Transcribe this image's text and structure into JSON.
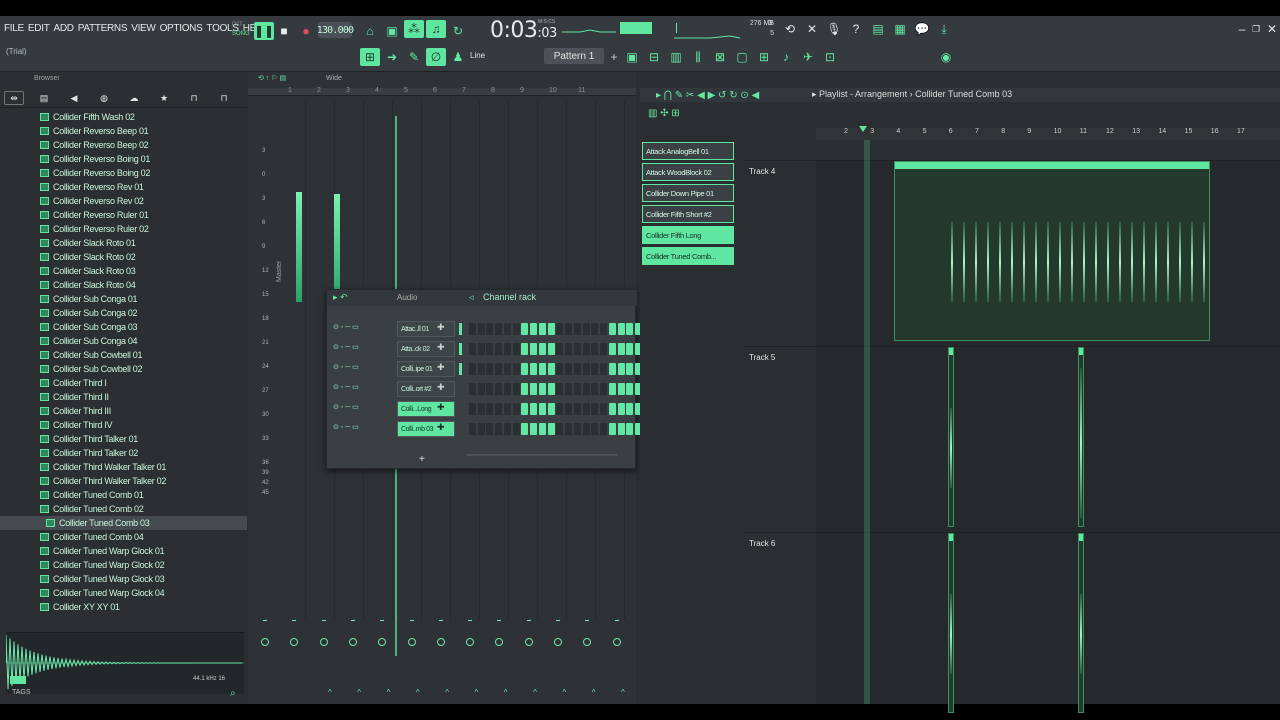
{
  "menu": [
    "FILE",
    "EDIT",
    "ADD",
    "PATTERNS",
    "VIEW",
    "OPTIONS",
    "TOOLS",
    "HELP"
  ],
  "trial_label": "(Trial)",
  "transport": {
    "pat_label": "PAT",
    "song_label": "SONG",
    "tempo": "130.000",
    "time_main": "0:03",
    "time_sub": ":03",
    "time_caption": "M:S:CS",
    "cpu_top": "3",
    "mem": "276 MB",
    "voices": "5"
  },
  "toolbar": {
    "snap_label": "Line",
    "pattern_label": "Pattern 1"
  },
  "browser": {
    "header": "Browser",
    "items": [
      "Collider Fifth Wash 02",
      "Collider Reverso Beep 01",
      "Collider Reverso Beep 02",
      "Collider Reverso Boing 01",
      "Collider Reverso Boing 02",
      "Collider Reverso Rev 01",
      "Collider Reverso Rev 02",
      "Collider Reverso Ruler 01",
      "Collider Reverso Ruler 02",
      "Collider Slack Roto 01",
      "Collider Slack Roto 02",
      "Collider Slack Roto 03",
      "Collider Slack Roto 04",
      "Collider Sub Conga 01",
      "Collider Sub Conga 02",
      "Collider Sub Conga 03",
      "Collider Sub Conga 04",
      "Collider Sub Cowbell 01",
      "Collider Sub Cowbell 02",
      "Collider Third I",
      "Collider Third II",
      "Collider Third III",
      "Collider Third IV",
      "Collider Third Talker 01",
      "Collider Third Talker 02",
      "Collider Third Walker Talker 01",
      "Collider Third Walker Talker 02",
      "Collider Tuned Comb 01",
      "Collider Tuned Comb 02",
      "Collider Tuned Comb 03",
      "Collider Tuned Comb 04",
      "Collider Tuned Warp Glock 01",
      "Collider Tuned Warp Glock 02",
      "Collider Tuned Warp Glock 03",
      "Collider Tuned Warp Glock 04",
      "Collider XY XY 01"
    ],
    "selected_index": 29,
    "sample_rate": "44.1 kHz 16",
    "tags_label": "TAGS"
  },
  "mixer": {
    "view_label": "Wide",
    "ruler": [
      "1",
      "2",
      "3",
      "4",
      "5",
      "6",
      "7",
      "8",
      "9",
      "10",
      "11"
    ],
    "db_labels": [
      "3",
      "0",
      "3",
      "6",
      "9",
      "12",
      "15",
      "18",
      "21",
      "24",
      "27",
      "30",
      "33",
      "36",
      "39",
      "42",
      "45"
    ],
    "master_label": "Master"
  },
  "channel_rack": {
    "title": "Channel rack",
    "group": "Audio",
    "channels": [
      {
        "name": "Attac..ll 01",
        "active": false,
        "steps": [
          0,
          0,
          0,
          0,
          0,
          0,
          1,
          1,
          1,
          1,
          0,
          0,
          0,
          0,
          0,
          0,
          1,
          1,
          1,
          1
        ]
      },
      {
        "name": "Atta..ck 02",
        "active": false,
        "steps": [
          0,
          0,
          0,
          0,
          0,
          0,
          1,
          1,
          1,
          1,
          0,
          0,
          0,
          0,
          0,
          0,
          1,
          1,
          1,
          1
        ]
      },
      {
        "name": "Colli..ipe 01",
        "active": false,
        "steps": [
          0,
          0,
          0,
          0,
          0,
          0,
          1,
          1,
          1,
          1,
          0,
          0,
          0,
          0,
          0,
          0,
          1,
          1,
          1,
          1
        ]
      },
      {
        "name": "Colli..ort #2",
        "active": false,
        "steps": [
          0,
          0,
          0,
          0,
          0,
          0,
          1,
          1,
          1,
          1,
          0,
          0,
          0,
          0,
          0,
          0,
          1,
          1,
          1,
          1
        ]
      },
      {
        "name": "Colli...Long",
        "active": true,
        "steps": [
          0,
          0,
          0,
          0,
          0,
          0,
          1,
          1,
          1,
          1,
          0,
          0,
          0,
          0,
          0,
          0,
          1,
          1,
          1,
          1
        ]
      },
      {
        "name": "Colli..mb 03",
        "active": true,
        "steps": [
          0,
          0,
          0,
          0,
          0,
          0,
          1,
          1,
          1,
          1,
          0,
          0,
          0,
          0,
          0,
          0,
          1,
          1,
          1,
          1
        ]
      }
    ]
  },
  "playlist": {
    "breadcrumb": "Playlist - Arrangement",
    "separator": "›",
    "current": "Collider Tuned Comb 03",
    "patterns": [
      {
        "name": "Attack AnalogBell 01",
        "active": false
      },
      {
        "name": "Attack WoodBlock 02",
        "active": false
      },
      {
        "name": "Collider Down Pipe 01",
        "active": false
      },
      {
        "name": "Collider Fifth Short #2",
        "active": false
      },
      {
        "name": "Collider Fifth Long",
        "active": true
      },
      {
        "name": "Collider Tuned Comb...",
        "active": true
      }
    ],
    "ruler": [
      "2",
      "3",
      "4",
      "5",
      "6",
      "7",
      "8",
      "9",
      "10",
      "11",
      "12",
      "13",
      "14",
      "15",
      "16",
      "17"
    ],
    "tracks": [
      "Track 4",
      "Track 5",
      "Track 6"
    ]
  },
  "colors": {
    "accent": "#5fe6a1",
    "background": "#2a2e31",
    "panel": "#353a3e"
  }
}
